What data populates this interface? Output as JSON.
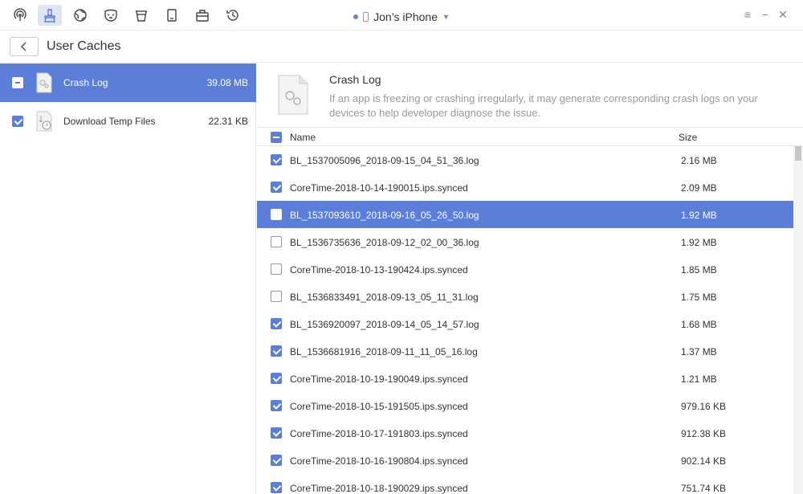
{
  "topbar": {
    "tools": [
      {
        "icon": "airbackup-icon"
      },
      {
        "icon": "cleaner-icon"
      },
      {
        "icon": "globe-icon"
      },
      {
        "icon": "mask-icon"
      },
      {
        "icon": "bucket-icon"
      },
      {
        "icon": "book-icon"
      },
      {
        "icon": "toolbox-icon"
      },
      {
        "icon": "history-icon"
      }
    ],
    "device_name": "Jon’s iPhone"
  },
  "header": {
    "title": "User Caches"
  },
  "sidebar": {
    "items": [
      {
        "label": "Crash Log",
        "size": "39.08 MB",
        "check": "partial",
        "selected": true
      },
      {
        "label": "Download Temp Files",
        "size": "22.31 KB",
        "check": "checked",
        "selected": false
      }
    ]
  },
  "info": {
    "title": "Crash Log",
    "description": "If an app is freezing or crashing irregularly, it may generate corresponding crash logs on your devices to help developer diagnose the issue."
  },
  "table": {
    "headers": {
      "name": "Name",
      "size": "Size"
    },
    "rows": [
      {
        "name": "BL_1537005096_2018-09-15_04_51_36.log",
        "size": "2.16 MB",
        "checked": true,
        "selected": false
      },
      {
        "name": "CoreTime-2018-10-14-190015.ips.synced",
        "size": "2.09 MB",
        "checked": true,
        "selected": false
      },
      {
        "name": "BL_1537093610_2018-09-16_05_26_50.log",
        "size": "1.92 MB",
        "checked": false,
        "selected": true
      },
      {
        "name": "BL_1536735636_2018-09-12_02_00_36.log",
        "size": "1.92 MB",
        "checked": false,
        "selected": false
      },
      {
        "name": "CoreTime-2018-10-13-190424.ips.synced",
        "size": "1.85 MB",
        "checked": false,
        "selected": false
      },
      {
        "name": "BL_1536833491_2018-09-13_05_11_31.log",
        "size": "1.75 MB",
        "checked": false,
        "selected": false
      },
      {
        "name": "BL_1536920097_2018-09-14_05_14_57.log",
        "size": "1.68 MB",
        "checked": true,
        "selected": false
      },
      {
        "name": "BL_1536681916_2018-09-11_11_05_16.log",
        "size": "1.37 MB",
        "checked": true,
        "selected": false
      },
      {
        "name": "CoreTime-2018-10-19-190049.ips.synced",
        "size": "1.21 MB",
        "checked": true,
        "selected": false
      },
      {
        "name": "CoreTime-2018-10-15-191505.ips.synced",
        "size": "979.16 KB",
        "checked": true,
        "selected": false
      },
      {
        "name": "CoreTime-2018-10-17-191803.ips.synced",
        "size": "912.38 KB",
        "checked": true,
        "selected": false
      },
      {
        "name": "CoreTime-2018-10-16-190804.ips.synced",
        "size": "902.14 KB",
        "checked": true,
        "selected": false
      },
      {
        "name": "CoreTime-2018-10-18-190029.ips.synced",
        "size": "751.74 KB",
        "checked": true,
        "selected": false
      }
    ]
  },
  "colors": {
    "accent": "#5b7fd8",
    "tool_active_bg": "#dfe5f5"
  }
}
